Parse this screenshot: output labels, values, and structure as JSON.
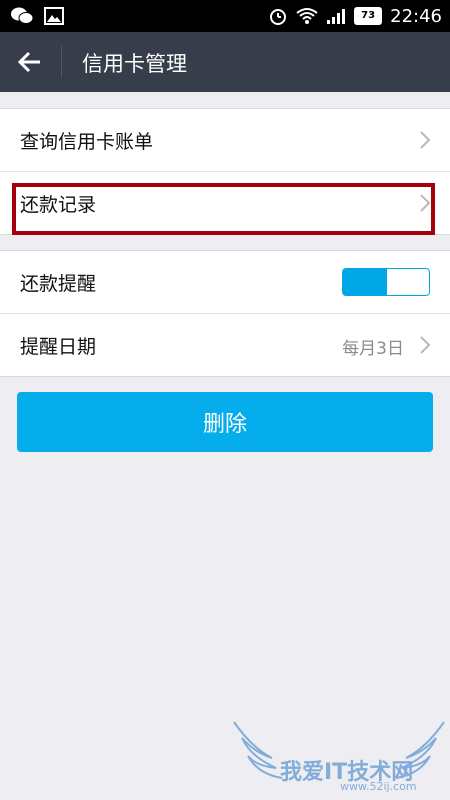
{
  "status_bar": {
    "time": "22:46",
    "battery": "73"
  },
  "header": {
    "title": "信用卡管理",
    "back_icon": "back-arrow-icon"
  },
  "group1": {
    "items": [
      {
        "label": "查询信用卡账单"
      },
      {
        "label": "还款记录"
      }
    ]
  },
  "group2": {
    "reminder": {
      "label": "还款提醒",
      "enabled": true
    },
    "date": {
      "label": "提醒日期",
      "value": "每月3日"
    }
  },
  "actions": {
    "delete_label": "删除"
  },
  "watermark": {
    "text": "我爱IT技术网",
    "url": "www.52ij.com"
  },
  "colors": {
    "accent": "#00a7e7",
    "titlebar": "#373d4a",
    "highlight": "#a5000b"
  }
}
